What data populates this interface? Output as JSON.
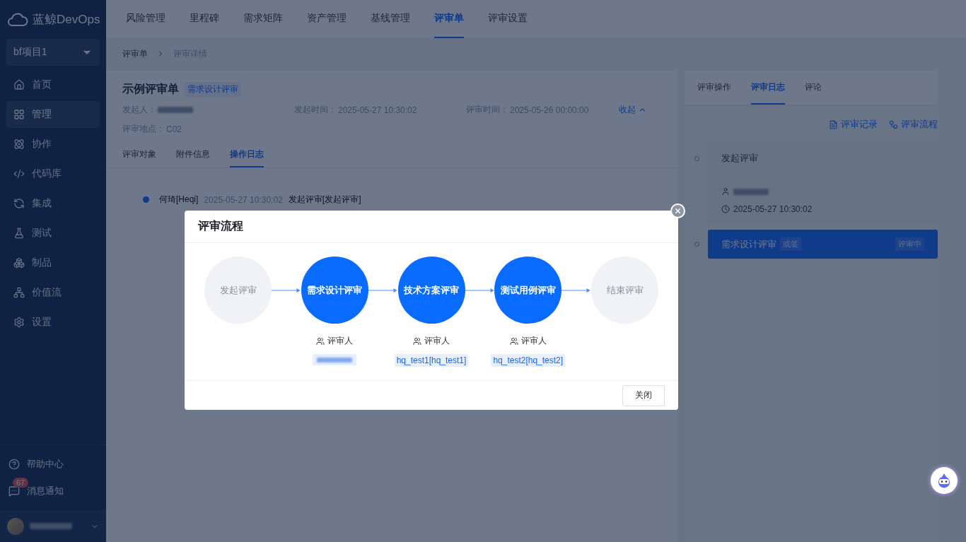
{
  "brand": {
    "name": "蓝鲸DevOps"
  },
  "project": {
    "label": "bf项目1"
  },
  "sidebar": {
    "items": [
      {
        "label": "首页",
        "selected": false
      },
      {
        "label": "管理",
        "selected": true
      },
      {
        "label": "协作",
        "selected": false
      },
      {
        "label": "代码库",
        "selected": false
      },
      {
        "label": "集成",
        "selected": false
      },
      {
        "label": "测试",
        "selected": false
      },
      {
        "label": "制品",
        "selected": false
      },
      {
        "label": "价值流",
        "selected": false
      },
      {
        "label": "设置",
        "selected": false
      }
    ],
    "footer": [
      {
        "label": "帮助中心"
      },
      {
        "label": "消息通知",
        "badge": "67"
      }
    ],
    "user": {
      "name_hidden": true
    }
  },
  "top_nav": [
    {
      "label": "风险管理",
      "selected": false
    },
    {
      "label": "里程碑",
      "selected": false
    },
    {
      "label": "需求矩阵",
      "selected": false
    },
    {
      "label": "资产管理",
      "selected": false
    },
    {
      "label": "基线管理",
      "selected": false
    },
    {
      "label": "评审单",
      "selected": true
    },
    {
      "label": "评审设置",
      "selected": false
    }
  ],
  "breadcrumb": [
    "评审单",
    "评审详情"
  ],
  "review": {
    "title": "示例评审单",
    "tag": "需求设计评审",
    "fields": [
      {
        "label": "发起人：",
        "value_hidden": true
      },
      {
        "label": "发起时间：",
        "value": "2025-05-27 10:30:02"
      },
      {
        "label": "评审时间：",
        "value": "2025-05-26 00:00:00"
      }
    ],
    "collapse": "收起",
    "location": {
      "label": "评审地点：",
      "value": "C02"
    },
    "tabs": [
      {
        "label": "评审对象",
        "selected": false
      },
      {
        "label": "附件信息",
        "selected": false
      },
      {
        "label": "操作日志",
        "selected": true
      }
    ],
    "log": [
      {
        "user": "何琦[Heqi]",
        "time": "2025-05-27 10:30:02",
        "action": "发起评审[发起评审]"
      }
    ]
  },
  "right_panel": {
    "tabs": [
      {
        "label": "评审操作",
        "selected": false
      },
      {
        "label": "评审日志",
        "selected": true
      },
      {
        "label": "评论",
        "selected": false
      }
    ],
    "links": [
      {
        "label": "评审记录"
      },
      {
        "label": "评审流程"
      }
    ],
    "timeline": [
      {
        "title": "发起评审",
        "active": false,
        "user_hidden": true,
        "time": "2025-05-27 10:30:02"
      },
      {
        "title": "需求设计评审",
        "active": true,
        "tag": "或签",
        "status": "评审中"
      }
    ]
  },
  "modal": {
    "title": "评审流程",
    "nodes": [
      {
        "label": "发起评审",
        "kind": "terminal"
      },
      {
        "label": "需求设计评审",
        "kind": "review",
        "reviewer_label": "评审人",
        "reviewer_hidden": true
      },
      {
        "label": "技术方案评审",
        "kind": "review",
        "reviewer_label": "评审人",
        "reviewer": "hq_test1[hq_test1]"
      },
      {
        "label": "测试用例评审",
        "kind": "review",
        "reviewer_label": "评审人",
        "reviewer": "hq_test2[hq_test2]"
      },
      {
        "label": "结束评审",
        "kind": "terminal"
      }
    ],
    "close_button": "关闭"
  }
}
